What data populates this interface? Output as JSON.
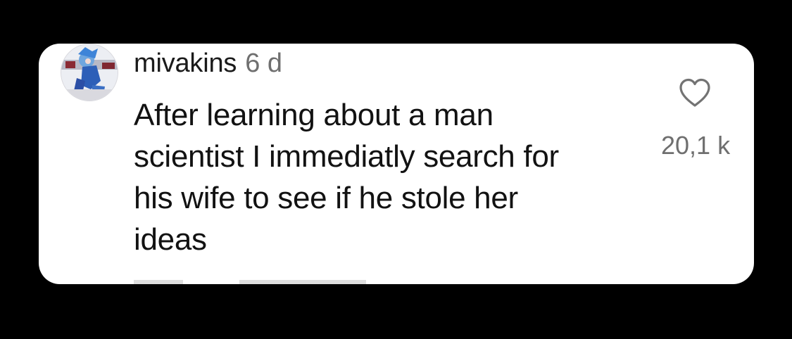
{
  "comment": {
    "username": "mivakins",
    "timestamp": "6 d",
    "text_lines": [
      "After learning about a man",
      "scientist I immediatly search for",
      "his wife to see if he stole her",
      "ideas"
    ],
    "like_count": "20,1 k",
    "icons": {
      "like": "heart-outline-icon",
      "avatar": "avatar"
    }
  },
  "colors": {
    "background": "#000000",
    "card": "#ffffff",
    "text": "#121212",
    "muted": "#6f6f6f"
  }
}
